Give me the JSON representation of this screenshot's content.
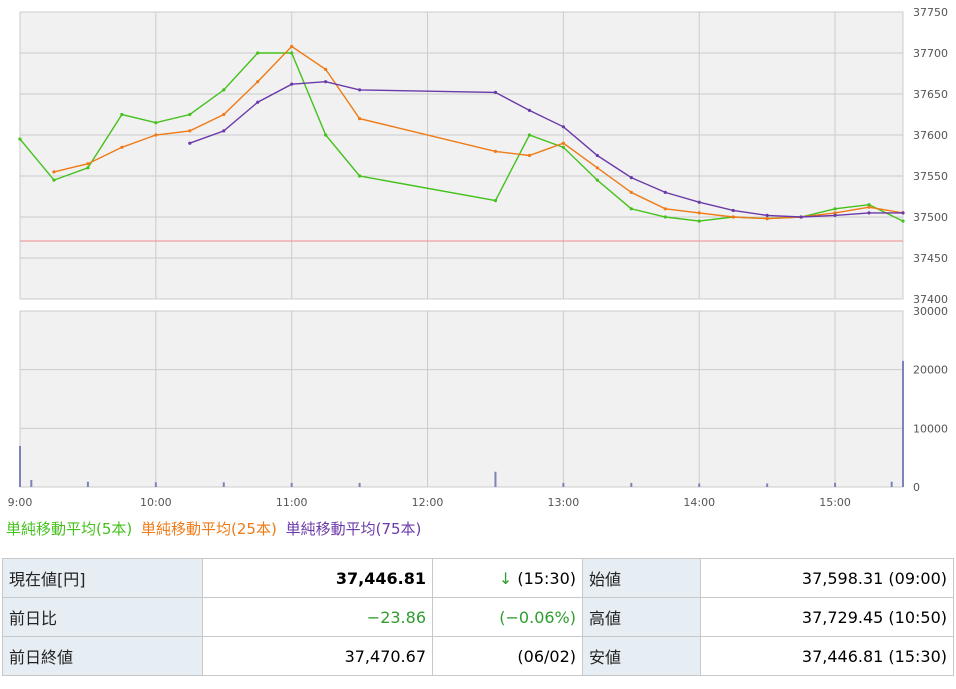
{
  "colors": {
    "ma5": "#44c11b",
    "ma25": "#ef7a16",
    "ma75": "#6b3aaa",
    "candle_up": "#c0392b",
    "candle_down": "#2a62a8",
    "prev_close_line": "#f08a8a",
    "volume": "#7d84b5",
    "plot_bg": "#f1f1f1",
    "grid": "#cccccc",
    "label_bg": "#e6eef4",
    "down_text": "#2f9d2f"
  },
  "chart_data": {
    "type": "line",
    "price_panel": {
      "x_ticks": [
        "9:00",
        "10:00",
        "11:00",
        "12:00",
        "13:00",
        "14:00",
        "15:00"
      ],
      "y_ticks": [
        "37400",
        "37450",
        "37500",
        "37550",
        "37600",
        "37650",
        "37700",
        "37750"
      ],
      "ylim": [
        37400,
        37750
      ],
      "prev_close_reference": 37470.67,
      "x": [
        "09:00",
        "09:15",
        "09:30",
        "09:45",
        "10:00",
        "10:15",
        "10:30",
        "10:45",
        "11:00",
        "11:15",
        "11:30",
        "12:30",
        "12:45",
        "13:00",
        "13:15",
        "13:30",
        "13:45",
        "14:00",
        "14:15",
        "14:30",
        "14:45",
        "15:00",
        "15:15",
        "15:30"
      ],
      "series": [
        {
          "name": "単純移動平均(5本)",
          "values": [
            37595,
            37545,
            37560,
            37625,
            37615,
            37625,
            37655,
            37700,
            37700,
            37600,
            37550,
            37520,
            37600,
            37585,
            37545,
            37510,
            37500,
            37495,
            37500,
            37498,
            37500,
            37510,
            37515,
            37495
          ]
        },
        {
          "name": "単純移動平均(25本)",
          "values": [
            null,
            37555,
            37565,
            37585,
            37600,
            37605,
            37625,
            37665,
            37708,
            37680,
            37620,
            37580,
            37575,
            37590,
            37560,
            37530,
            37510,
            37505,
            37500,
            37498,
            37500,
            37505,
            37512,
            37505
          ]
        },
        {
          "name": "単純移動平均(75本)",
          "values": [
            null,
            null,
            null,
            null,
            null,
            37590,
            37605,
            37640,
            37662,
            37665,
            37655,
            37652,
            37630,
            37610,
            37575,
            37548,
            37530,
            37518,
            37508,
            37502,
            37500,
            37502,
            37505,
            37505
          ]
        }
      ]
    },
    "volume_panel": {
      "y_ticks": [
        "0",
        "10000",
        "20000",
        "30000"
      ],
      "ylim": [
        0,
        30000
      ],
      "x": [
        "09:00",
        "09:05",
        "09:30",
        "10:00",
        "10:30",
        "11:00",
        "11:30",
        "12:30",
        "13:00",
        "13:30",
        "14:00",
        "14:30",
        "15:00",
        "15:25",
        "15:30"
      ],
      "values": [
        7000,
        1200,
        900,
        800,
        800,
        700,
        700,
        2600,
        700,
        700,
        600,
        600,
        700,
        900,
        21500
      ]
    }
  },
  "legend": {
    "ma5": "単純移動平均(5本)",
    "ma25": "単純移動平均(25本)",
    "ma75": "単純移動平均(75本)"
  },
  "quote": {
    "current_label": "現在値[円]",
    "current_value": "37,446.81",
    "current_arrow": "↓",
    "current_time": "(15:30)",
    "open_label": "始値",
    "open_value": "37,598.31 (09:00)",
    "change_label": "前日比",
    "change_value": "−23.86",
    "change_pct": "(−0.06%)",
    "high_label": "高値",
    "high_value": "37,729.45 (10:50)",
    "prev_close_label": "前日終値",
    "prev_close_value": "37,470.67",
    "prev_close_date": "(06/02)",
    "low_label": "安値",
    "low_value": "37,446.81 (15:30)"
  }
}
